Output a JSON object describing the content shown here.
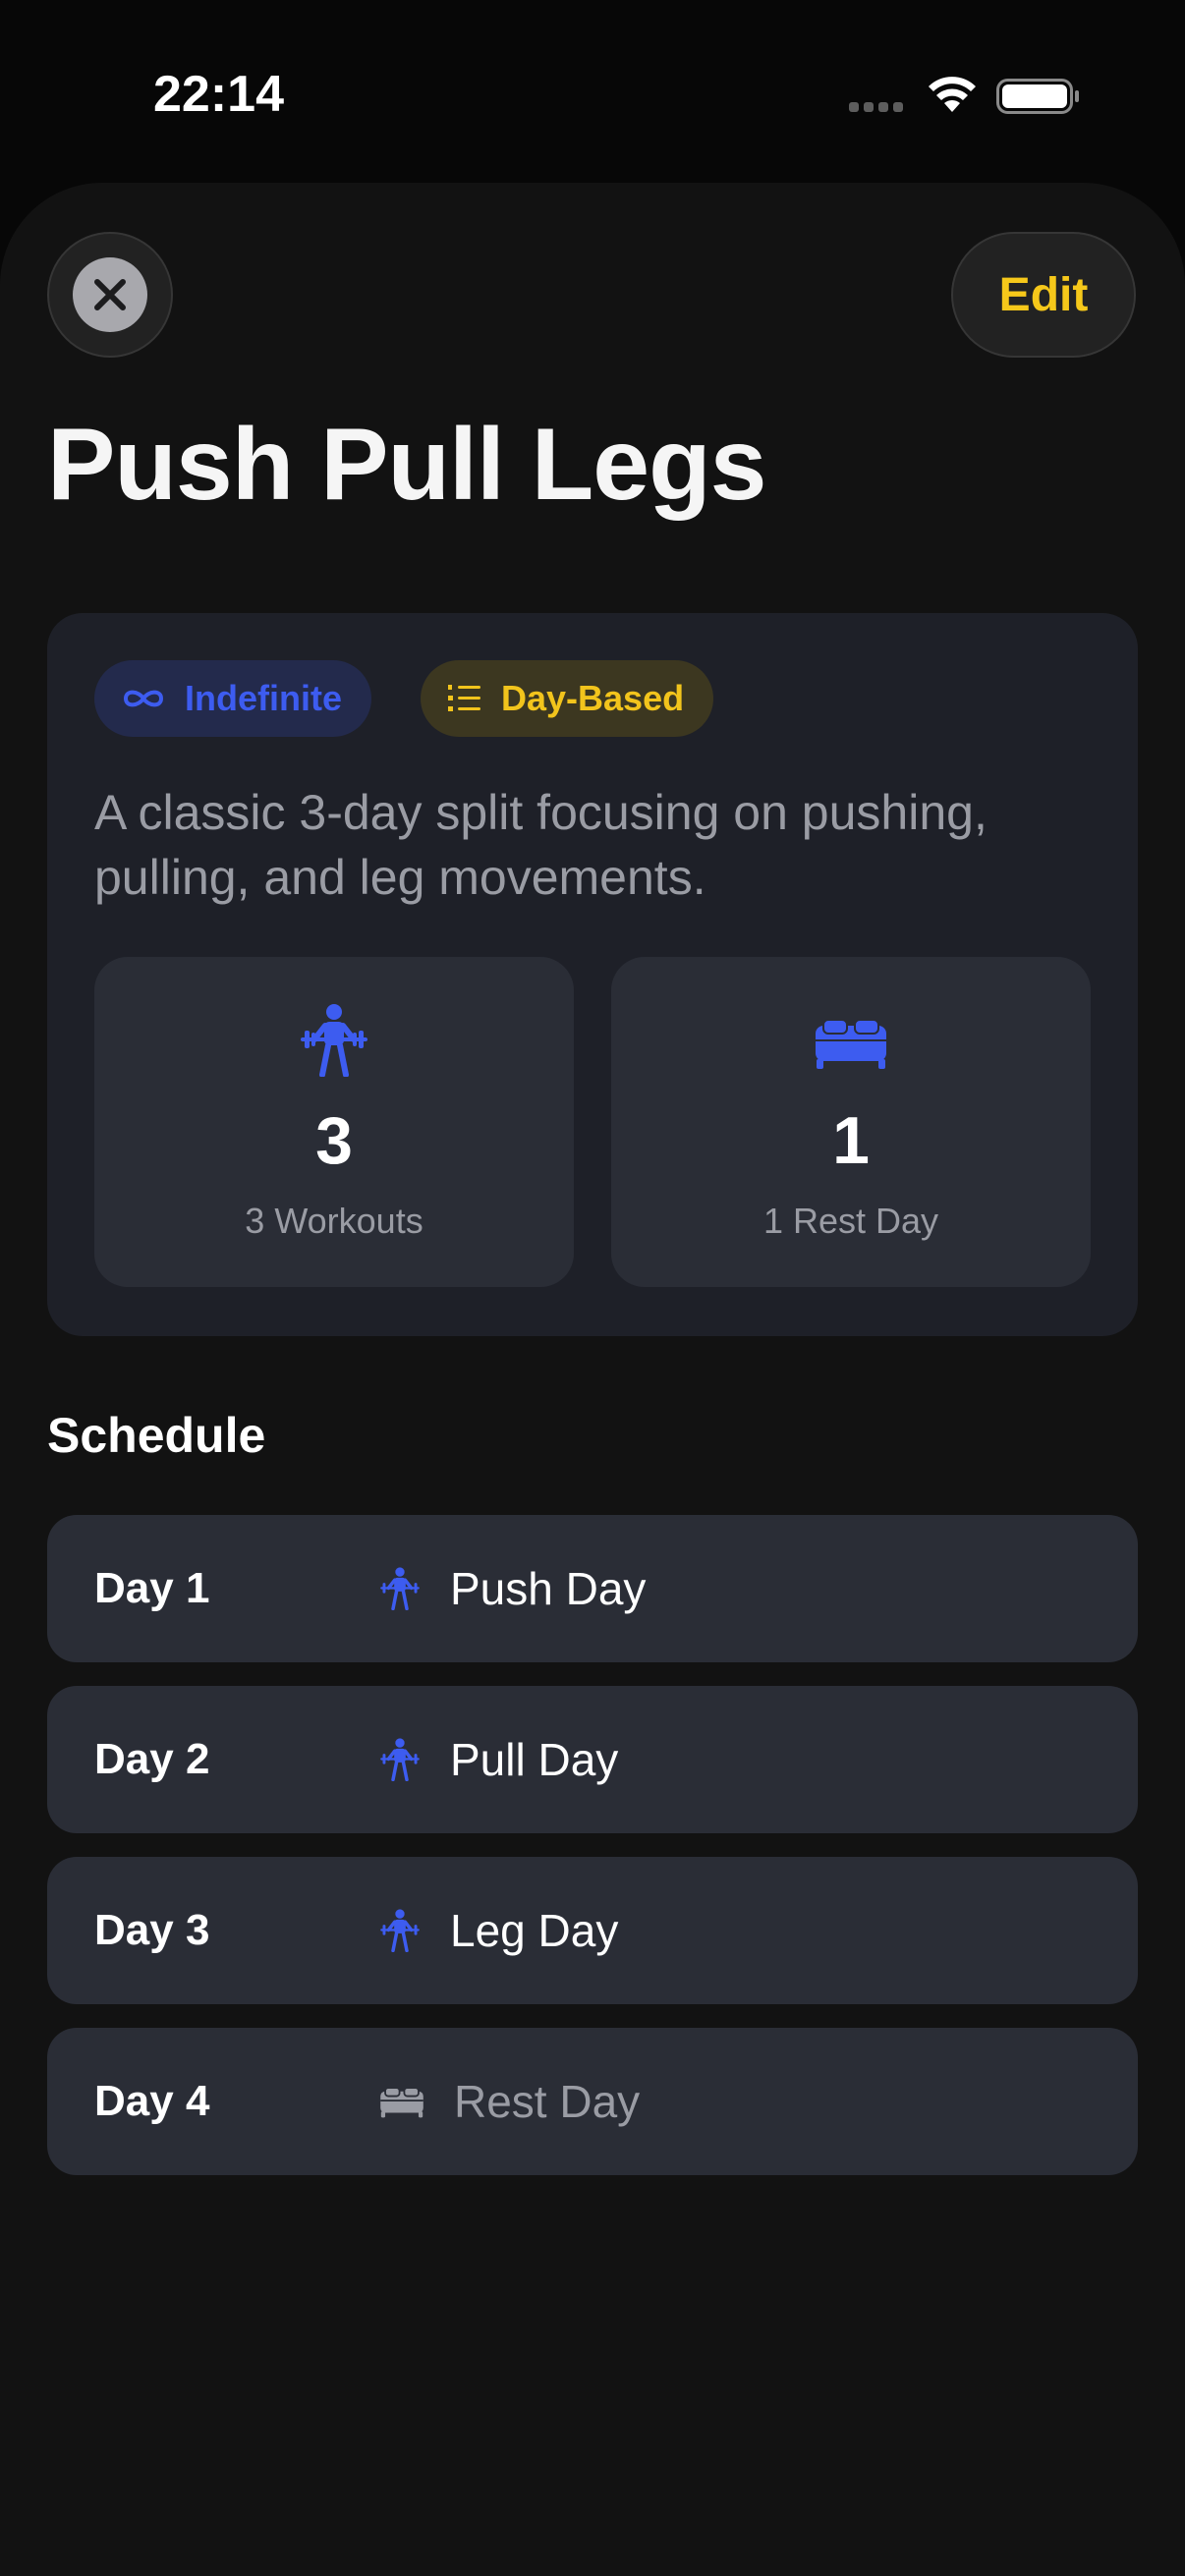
{
  "status_bar": {
    "time": "22:14"
  },
  "header": {
    "close_icon": "xmark-icon",
    "edit_label": "Edit",
    "title": "Push Pull Legs"
  },
  "info_card": {
    "badges": [
      {
        "label": "Indefinite",
        "icon": "infinity-icon",
        "color": "#3d5cf0"
      },
      {
        "label": "Day-Based",
        "icon": "numbered-list-icon",
        "color": "#f2c41c"
      }
    ],
    "description": "A classic 3-day split focusing on pushing, pulling, and leg movements.",
    "stats": [
      {
        "value": "3",
        "label": "3 Workouts",
        "icon": "weightlifter-icon"
      },
      {
        "value": "1",
        "label": "1 Rest Day",
        "icon": "bed-icon"
      }
    ]
  },
  "schedule": {
    "heading": "Schedule",
    "days": [
      {
        "day": "Day 1",
        "name": "Push Day",
        "icon": "weightlifter-icon"
      },
      {
        "day": "Day 2",
        "name": "Pull Day",
        "icon": "weightlifter-icon"
      },
      {
        "day": "Day 3",
        "name": "Leg Day",
        "icon": "weightlifter-icon"
      },
      {
        "day": "Day 4",
        "name": "Rest Day",
        "icon": "bed-icon"
      }
    ]
  },
  "colors": {
    "accent_blue": "#3d5cf0",
    "accent_yellow": "#f2c41c",
    "background": "#121212",
    "card": "#1e2028",
    "tile": "#2a2d36"
  }
}
